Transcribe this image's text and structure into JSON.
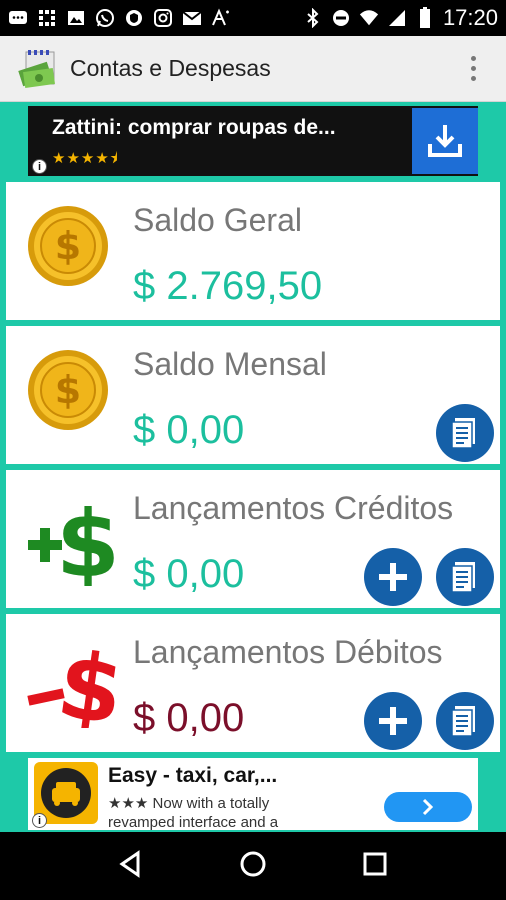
{
  "status_bar": {
    "time": "17:20",
    "icons": [
      "whatsapp-icon",
      "gallery-icon",
      "whatsapp-icon",
      "shield-icon",
      "instagram-icon",
      "mail-icon",
      "text-icon",
      "bluetooth-icon",
      "do-not-disturb-icon",
      "wifi-icon",
      "signal-icon",
      "battery-icon"
    ]
  },
  "app_bar": {
    "title": "Contas e Despesas"
  },
  "ad_top": {
    "text": "Zattini: comprar roupas de...",
    "rating_stars": "★★★★⯨",
    "info": "i"
  },
  "cards": [
    {
      "label": "Saldo Geral",
      "value": "$ 2.769,50"
    },
    {
      "label": "Saldo Mensal",
      "value": "$ 0,00"
    },
    {
      "label": "Lançamentos Créditos",
      "value": "$ 0,00"
    },
    {
      "label": "Lançamentos Débitos",
      "value": "$ 0,00"
    }
  ],
  "ad_bottom": {
    "title": "Easy - taxi, car,...",
    "line1": "★★★ Now with a totally",
    "line2": "revamped interface and a",
    "info": "i"
  },
  "colors": {
    "accent": "#1ec9a8",
    "positive": "#1cbf9e",
    "negative": "#7b0f2a",
    "button": "#1560a8"
  }
}
